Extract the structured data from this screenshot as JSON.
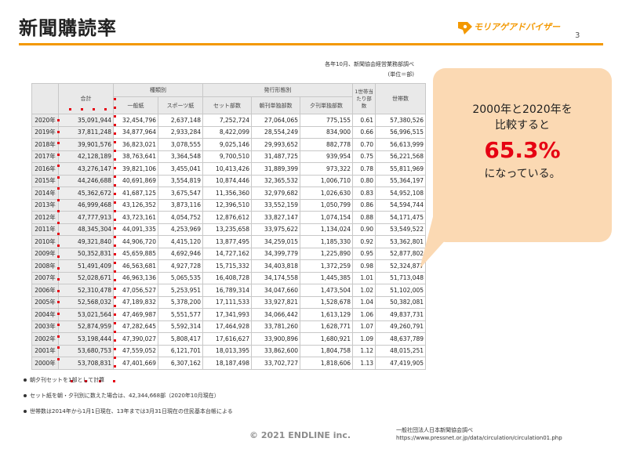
{
  "title": "新聞購読率",
  "logo": {
    "text": "モリアゲアドバイザー"
  },
  "page_number": "3",
  "source_note": {
    "line1": "各年10月、新聞協会経営業務部調べ",
    "line2": "(単位＝部)"
  },
  "table": {
    "group_headers": {
      "total": "合計",
      "by_type": "種類別",
      "by_issue": "発行形態別",
      "per_household": "1世帯当たり部数",
      "households": "世帯数"
    },
    "sub_headers": {
      "general": "一般紙",
      "sports": "スポーツ紙",
      "set": "セット部数",
      "morning": "朝刊単独部数",
      "evening": "夕刊単独部数"
    },
    "rows": [
      [
        "2020年",
        "35,091,944",
        "32,454,796",
        "2,637,148",
        "7,252,724",
        "27,064,065",
        "775,155",
        "0.61",
        "57,380,526"
      ],
      [
        "2019年",
        "37,811,248",
        "34,877,964",
        "2,933,284",
        "8,422,099",
        "28,554,249",
        "834,900",
        "0.66",
        "56,996,515"
      ],
      [
        "2018年",
        "39,901,576",
        "36,823,021",
        "3,078,555",
        "9,025,146",
        "29,993,652",
        "882,778",
        "0.70",
        "56,613,999"
      ],
      [
        "2017年",
        "42,128,189",
        "38,763,641",
        "3,364,548",
        "9,700,510",
        "31,487,725",
        "939,954",
        "0.75",
        "56,221,568"
      ],
      [
        "2016年",
        "43,276,147",
        "39,821,106",
        "3,455,041",
        "10,413,426",
        "31,889,399",
        "973,322",
        "0.78",
        "55,811,969"
      ],
      [
        "2015年",
        "44,246,688",
        "40,691,869",
        "3,554,819",
        "10,874,446",
        "32,365,532",
        "1,006,710",
        "0.80",
        "55,364,197"
      ],
      [
        "2014年",
        "45,362,672",
        "41,687,125",
        "3,675,547",
        "11,356,360",
        "32,979,682",
        "1,026,630",
        "0.83",
        "54,952,108"
      ],
      [
        "2013年",
        "46,999,468",
        "43,126,352",
        "3,873,116",
        "12,396,510",
        "33,552,159",
        "1,050,799",
        "0.86",
        "54,594,744"
      ],
      [
        "2012年",
        "47,777,913",
        "43,723,161",
        "4,054,752",
        "12,876,612",
        "33,827,147",
        "1,074,154",
        "0.88",
        "54,171,475"
      ],
      [
        "2011年",
        "48,345,304",
        "44,091,335",
        "4,253,969",
        "13,235,658",
        "33,975,622",
        "1,134,024",
        "0.90",
        "53,549,522"
      ],
      [
        "2010年",
        "49,321,840",
        "44,906,720",
        "4,415,120",
        "13,877,495",
        "34,259,015",
        "1,185,330",
        "0.92",
        "53,362,801"
      ],
      [
        "2009年",
        "50,352,831",
        "45,659,885",
        "4,692,946",
        "14,727,162",
        "34,399,779",
        "1,225,890",
        "0.95",
        "52,877,802"
      ],
      [
        "2008年",
        "51,491,409",
        "46,563,681",
        "4,927,728",
        "15,715,332",
        "34,403,818",
        "1,372,259",
        "0.98",
        "52,324,877"
      ],
      [
        "2007年",
        "52,028,671",
        "46,963,136",
        "5,065,535",
        "16,408,728",
        "34,174,558",
        "1,445,385",
        "1.01",
        "51,713,048"
      ],
      [
        "2006年",
        "52,310,478",
        "47,056,527",
        "5,253,951",
        "16,789,314",
        "34,047,660",
        "1,473,504",
        "1.02",
        "51,102,005"
      ],
      [
        "2005年",
        "52,568,032",
        "47,189,832",
        "5,378,200",
        "17,111,533",
        "33,927,821",
        "1,528,678",
        "1.04",
        "50,382,081"
      ],
      [
        "2004年",
        "53,021,564",
        "47,469,987",
        "5,551,577",
        "17,341,993",
        "34,066,442",
        "1,613,129",
        "1.06",
        "49,837,731"
      ],
      [
        "2003年",
        "52,874,959",
        "47,282,645",
        "5,592,314",
        "17,464,928",
        "33,781,260",
        "1,628,771",
        "1.07",
        "49,260,791"
      ],
      [
        "2002年",
        "53,198,444",
        "47,390,027",
        "5,808,417",
        "17,616,627",
        "33,900,896",
        "1,680,921",
        "1.09",
        "48,637,789"
      ],
      [
        "2001年",
        "53,680,753",
        "47,559,052",
        "6,121,701",
        "18,013,395",
        "33,862,600",
        "1,804,758",
        "1.12",
        "48,015,251"
      ],
      [
        "2000年",
        "53,708,831",
        "47,401,669",
        "6,307,162",
        "18,187,498",
        "33,702,727",
        "1,818,606",
        "1.13",
        "47,419,905"
      ]
    ]
  },
  "notes": [
    "朝夕刊セットを1部として計算",
    "セット紙を朝・夕刊別に数えた場合は、42,344,668部（2020年10月現在）",
    "世帯数は2014年から1月1日現在、13年までは3月31日現在の住民基本台帳による"
  ],
  "callout": {
    "line1": "2000年と2020年を",
    "line2": "比較すると",
    "highlight": "65.3%",
    "line3": "になっている。"
  },
  "copyright": "© 2021 ENDLINE inc.",
  "citation": {
    "org": "一般社団法人日本新聞協会調べ",
    "url": "https://www.pressnet.or.jp/data/circulation/circulation01.php"
  },
  "colors": {
    "accent": "#f39800",
    "highlight": "#e60012",
    "callout_bg": "#fbd9b3"
  }
}
